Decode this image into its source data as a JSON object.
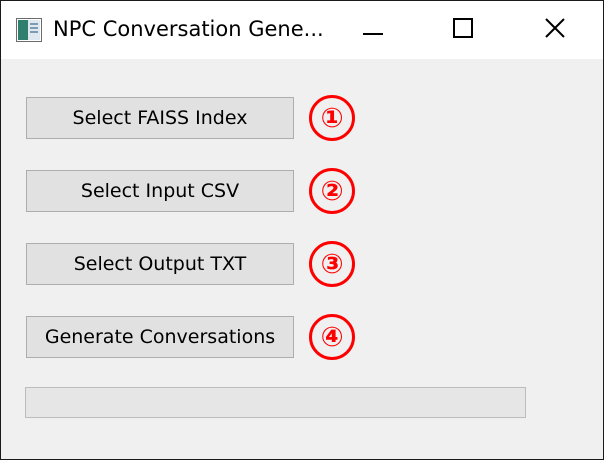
{
  "window": {
    "title": "NPC Conversation Gene..."
  },
  "buttons": {
    "select_faiss": "Select FAISS Index",
    "select_csv": "Select Input CSV",
    "select_txt": "Select Output TXT",
    "generate": "Generate Conversations"
  },
  "markers": [
    "①",
    "②",
    "③",
    "④"
  ],
  "progress": {
    "value": 0
  },
  "colors": {
    "marker_red": "#ff0000",
    "progress_fill": "#06b025"
  },
  "icons": {
    "app": "app-window-icon",
    "minimize": "minimize-icon",
    "maximize": "maximize-icon",
    "close": "close-icon"
  }
}
